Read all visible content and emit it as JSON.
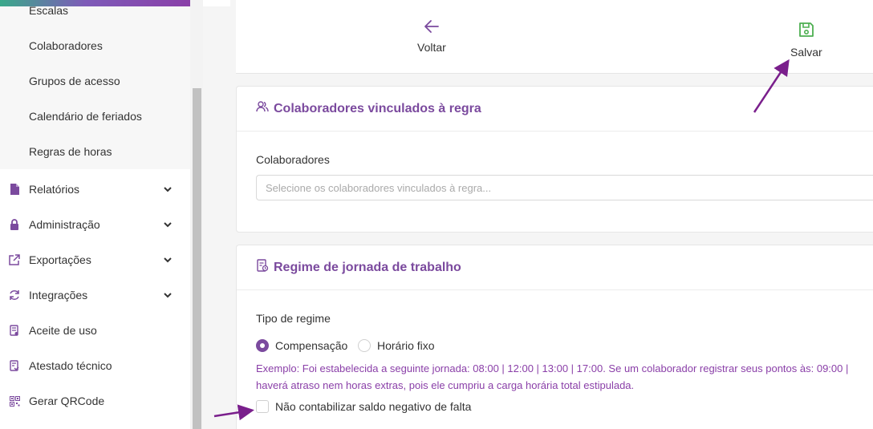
{
  "sidebar": {
    "submenu": [
      "Escalas",
      "Colaboradores",
      "Grupos de acesso",
      "Calendário de feriados",
      "Regras de horas"
    ],
    "items": [
      {
        "label": "Relatórios",
        "icon": "document-icon",
        "expandable": true
      },
      {
        "label": "Administração",
        "icon": "lock-icon",
        "expandable": true
      },
      {
        "label": "Exportações",
        "icon": "export-icon",
        "expandable": true
      },
      {
        "label": "Integrações",
        "icon": "sync-icon",
        "expandable": true
      },
      {
        "label": "Aceite de uso",
        "icon": "contract-icon",
        "expandable": false
      },
      {
        "label": "Atestado técnico",
        "icon": "certificate-icon",
        "expandable": false
      },
      {
        "label": "Gerar QRCode",
        "icon": "qrcode-icon",
        "expandable": false
      }
    ]
  },
  "actions": {
    "back_label": "Voltar",
    "save_label": "Salvar"
  },
  "collaborators_card": {
    "title": "Colaboradores vinculados à regra",
    "field_label": "Colaboradores",
    "placeholder": "Selecione os colaboradores vinculados à regra..."
  },
  "regime_card": {
    "title": "Regime de jornada de trabalho",
    "field_label": "Tipo de regime",
    "options": [
      {
        "label": "Compensação",
        "selected": true
      },
      {
        "label": "Horário fixo",
        "selected": false
      }
    ],
    "example_line1": "Exemplo: Foi estabelecida a seguinte jornada: 08:00 | 12:00 | 13:00 | 17:00. Se um colaborador registrar seus pontos às: 09:00 |",
    "example_line2": "haverá atraso nem horas extras, pois ele cumpriu a carga horária total estipulada.",
    "checkbox_label": "Não contabilizar saldo negativo de falta",
    "checkbox_checked": false
  },
  "colors": {
    "accent": "#7b4a9e",
    "save_icon": "#4caf50",
    "annotation_arrow": "#7a1f8c"
  }
}
